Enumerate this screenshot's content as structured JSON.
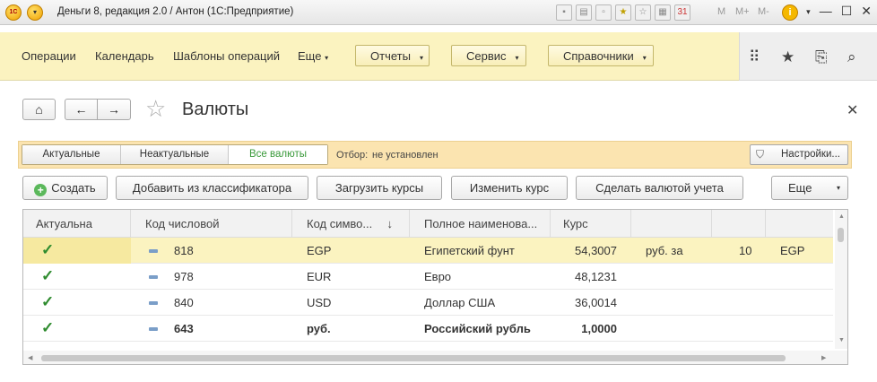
{
  "window": {
    "title": "Деньги 8, редакция 2.0 / Антон  (1С:Предприятие)",
    "logo": "1C",
    "m_buttons": [
      "M",
      "M+",
      "M-"
    ]
  },
  "sections": {
    "links": [
      "Операции",
      "Календарь",
      "Шаблоны операций",
      "Еще"
    ],
    "buttons": [
      "Отчеты",
      "Сервис",
      "Справочники"
    ]
  },
  "form": {
    "title": "Валюты"
  },
  "filter": {
    "segments": [
      "Актуальные",
      "Неактуальные",
      "Все валюты"
    ],
    "active_segment": "Все валюты",
    "label": "Отбор:",
    "value": "не установлен",
    "settings_label": "Настройки..."
  },
  "commands": {
    "create": "Создать",
    "add_from_classifier": "Добавить из классификатора",
    "load_rates": "Загрузить курсы",
    "change_rate": "Изменить курс",
    "make_accounting": "Сделать валютой учета",
    "more": "Еще"
  },
  "table": {
    "columns": [
      "Актуальна",
      "Код числовой",
      "Код симво...",
      "Полное наименова...",
      "Курс"
    ],
    "sort_indicator": "↓",
    "rows": [
      {
        "code": "818",
        "symbol": "EGP",
        "name": "Египетский фунт",
        "rate": "54,3007",
        "unit": "руб. за",
        "mult": "10",
        "base": "EGP",
        "selected": true,
        "bold": false
      },
      {
        "code": "978",
        "symbol": "EUR",
        "name": "Евро",
        "rate": "48,1231",
        "unit": "",
        "mult": "",
        "base": "",
        "selected": false,
        "bold": false
      },
      {
        "code": "840",
        "symbol": "USD",
        "name": "Доллар США",
        "rate": "36,0014",
        "unit": "",
        "mult": "",
        "base": "",
        "selected": false,
        "bold": false
      },
      {
        "code": "643",
        "symbol": "руб.",
        "name": "Российский рубль",
        "rate": "1,0000",
        "unit": "",
        "mult": "",
        "base": "",
        "selected": false,
        "bold": true
      }
    ]
  },
  "colors": {
    "section_bg": "#fbf3c0",
    "filter_bg": "#fbe4b0",
    "active_green": "#3a9a3a",
    "check_green": "#2e8b2e"
  }
}
